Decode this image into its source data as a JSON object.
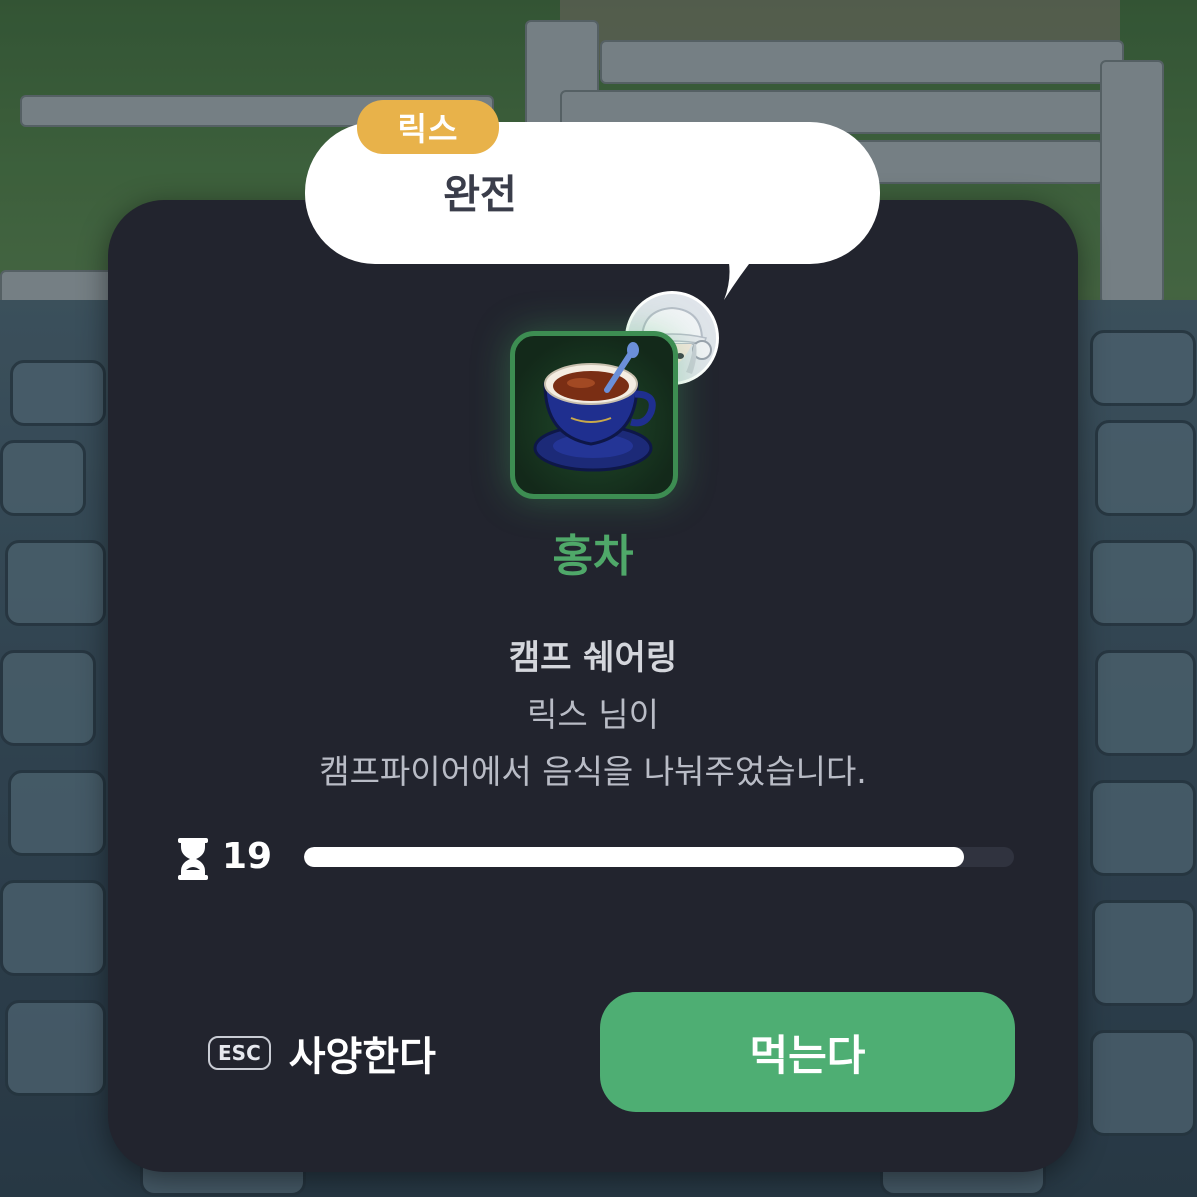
{
  "speech": {
    "speaker": "릭스",
    "text": "완전"
  },
  "item": {
    "name": "홍차",
    "icon": "black-tea-cup-icon",
    "name_color": "#4fa869"
  },
  "message": {
    "title": "캠프 쉐어링",
    "line1": "릭스 님이",
    "line2": "캠프파이어에서 음식을 나눠주었습니다."
  },
  "timer": {
    "icon": "hourglass-icon",
    "value": "19",
    "progress_fraction": 0.93
  },
  "actions": {
    "decline_key": "ESC",
    "decline_label": "사양한다",
    "accept_label": "먹는다",
    "accept_color": "#4eae73"
  }
}
